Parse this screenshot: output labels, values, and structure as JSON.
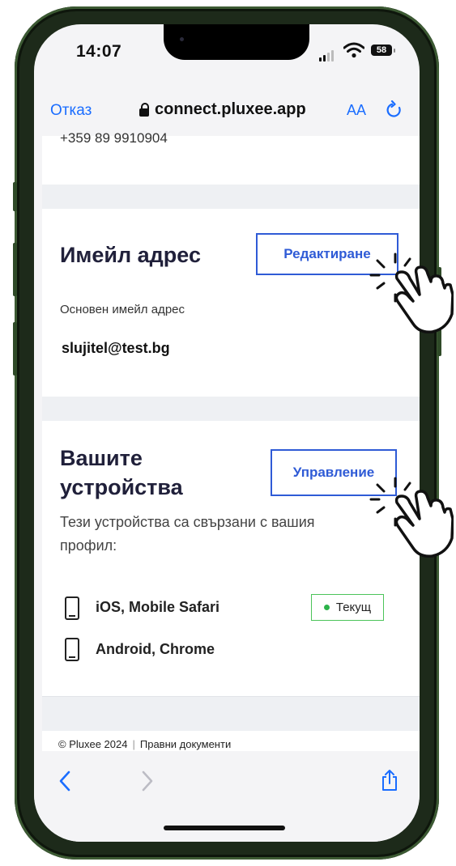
{
  "status": {
    "time": "14:07",
    "battery": "58"
  },
  "browser": {
    "cancel_label": "Отказ",
    "url": "connect.pluxee.app",
    "text_size_label": "AA"
  },
  "page": {
    "phone_partial": "+359 89 9910904",
    "email_section": {
      "title": "Имейл адрес",
      "edit_button": "Редактиране",
      "field_label": "Основен имейл адрес",
      "email": "slujitel@test.bg"
    },
    "devices_section": {
      "title_line1": "Вашите",
      "title_line2": "устройства",
      "manage_button": "Управление",
      "description_line1": "Тези устройства са свързани с вашия",
      "description_line2": "профил:",
      "devices": [
        {
          "name": "iOS, Mobile Safari",
          "badge": "Текущ"
        },
        {
          "name": "Android, Chrome"
        }
      ]
    },
    "footer": {
      "copyright": "© Pluxee 2024",
      "legal_link": "Правни документи"
    }
  },
  "colors": {
    "accent": "#2f5bd6",
    "link": "#1a6dff",
    "current_green": "#2cb34a"
  }
}
